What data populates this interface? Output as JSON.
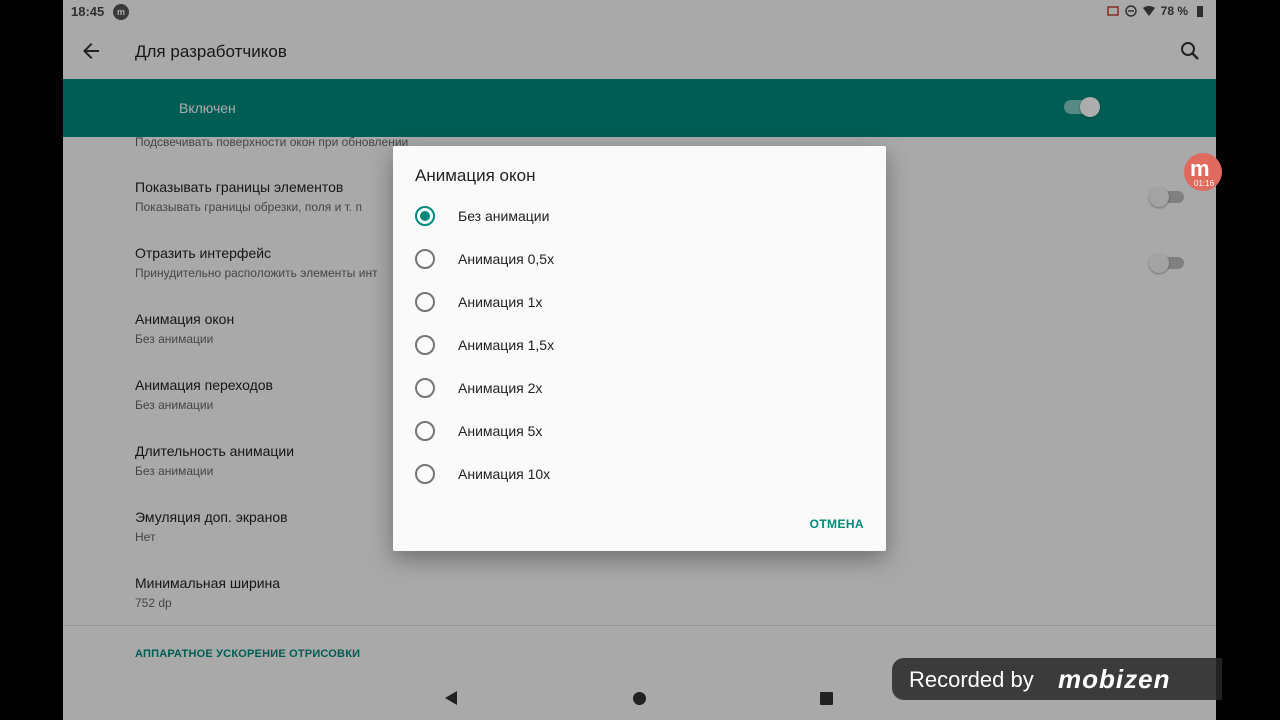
{
  "status_bar": {
    "time": "18:45",
    "notification_badge": "m",
    "battery": "78 %"
  },
  "app_bar": {
    "title": "Для разработчиков"
  },
  "master_switch": {
    "label": "Включен",
    "state": "on"
  },
  "settings": {
    "cut_summary": "Подсвечивать поверхности окон при обновлении",
    "items": [
      {
        "title": "Показывать границы элементов",
        "summary": "Показывать границы обрезки, поля и т. п",
        "switch": "off"
      },
      {
        "title": "Отразить интерфейс",
        "summary": "Принудительно расположить элементы инт",
        "switch": "off"
      },
      {
        "title": "Анимация окон",
        "summary": "Без анимации"
      },
      {
        "title": "Анимация переходов",
        "summary": "Без анимации"
      },
      {
        "title": "Длительность анимации",
        "summary": "Без анимации"
      },
      {
        "title": "Эмуляция доп. экранов",
        "summary": "Нет"
      },
      {
        "title": "Минимальная ширина",
        "summary": "752 dp"
      }
    ],
    "section_header": "АППАРАТНОЕ УСКОРЕНИЕ ОТРИСОВКИ"
  },
  "dialog": {
    "title": "Анимация окон",
    "options": [
      "Без анимации",
      "Анимация 0,5x",
      "Анимация 1x",
      "Анимация 1,5x",
      "Анимация 2x",
      "Анимация 5x",
      "Анимация 10x"
    ],
    "selected_index": 0,
    "cancel_label": "ОТМЕНА"
  },
  "recorder": {
    "bubble_letter": "m",
    "bubble_time": "01:16",
    "watermark_prefix": "Recorded by",
    "watermark_brand": "mobizen"
  },
  "colors": {
    "accent": "#00897b"
  }
}
